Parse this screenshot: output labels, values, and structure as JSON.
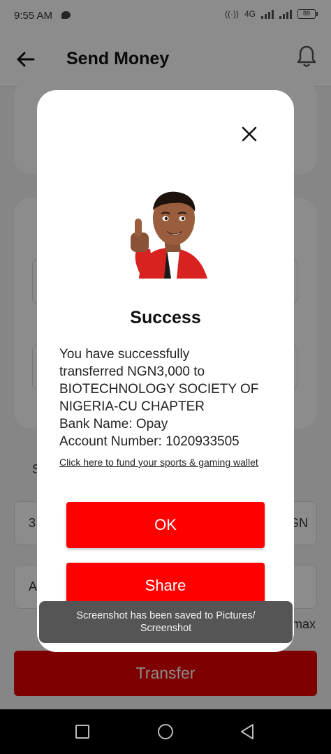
{
  "status_bar": {
    "time": "9:55 AM",
    "network": "4G",
    "battery": "88",
    "chat_icon": "message-icon",
    "hotspot_icon": "hotspot-icon"
  },
  "app_bar": {
    "title": "Send Money",
    "back_icon": "arrow-left-icon",
    "notification_icon": "bell-icon"
  },
  "background": {
    "amount_prefix": "3",
    "currency_suffix": "GN",
    "field_prefix": "A",
    "section_prefix": "S",
    "max_label": "max",
    "transfer_label": "Transfer"
  },
  "modal": {
    "close_icon": "close-icon",
    "title": "Success",
    "message_lines": [
      "You have successfully",
      "transferred NGN3,000 to",
      "BIOTECHNOLOGY SOCIETY OF",
      "NIGERIA-CU CHAPTER",
      "Bank Name: Opay",
      "Account Number: 1020933505"
    ],
    "link_text": "Click here to  fund your sports & gaming wallet",
    "ok_label": "OK",
    "share_label": "Share"
  },
  "toast": {
    "line1": "Screenshot has been saved to  Pictures/",
    "line2": "Screenshot"
  },
  "nav_bar": {
    "recent_icon": "square-icon",
    "home_icon": "circle-icon",
    "back_icon": "triangle-back-icon"
  },
  "colors": {
    "brand_red": "#ff0000",
    "transfer_red": "#e60000",
    "toast_bg": "#555555"
  }
}
